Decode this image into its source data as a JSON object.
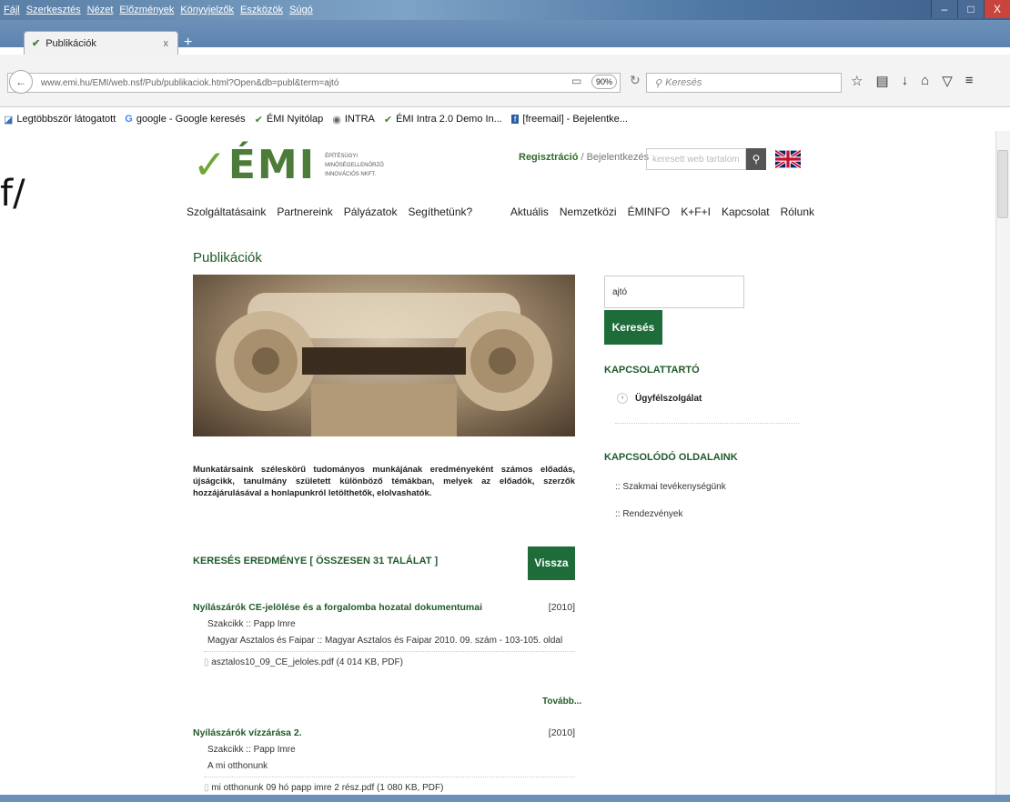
{
  "menu": [
    "Fájl",
    "Szerkesztés",
    "Nézet",
    "Előzmények",
    "Könyvjelzők",
    "Eszközök",
    "Súgó"
  ],
  "tab": {
    "title": "Publikációk",
    "close": "x",
    "new": "+"
  },
  "window_controls": [
    "–",
    "□",
    "X"
  ],
  "urlbar": {
    "url": "www.emi.hu/EMI/web.nsf/Pub/publikaciok.html?Open&db=publ&term=ajtó",
    "zoom": "90%",
    "search_placeholder": "Keresés"
  },
  "bookmarks": [
    "Legtöbbször látogatott",
    "google - Google keresés",
    "ÉMI Nyitólap",
    "INTRA",
    "ÉMI Intra 2.0 Demo In...",
    "[freemail] - Bejelentke..."
  ],
  "left_fragment": "f/",
  "logo": {
    "mark": "ÉMI",
    "text": [
      "ÉPÍTÉSÜGYI",
      "MINŐSÉGELLENŐRZŐ",
      "INNOVÁCIÓS NKFT."
    ]
  },
  "header": {
    "register": "Regisztráció",
    "slash": " / ",
    "login": "Bejelentkezés",
    "search_placeholder": "keresett web tartalom"
  },
  "nav": {
    "left": [
      "Szolgáltatásaink",
      "Partnereink",
      "Pályázatok",
      "Segíthetünk?"
    ],
    "right": [
      "Aktuális",
      "Nemzetközi",
      "ÉMINFO",
      "K+F+I",
      "Kapcsolat",
      "Rólunk"
    ]
  },
  "page_title": "Publikációk",
  "intro": "Munkatársaink széleskörű tudományos munkájának eredményeként számos előadás, újságcikk, tanulmány született különböző témákban, melyek az előadók, szerzők hozzájárulásával a honlapunkról letölthetők, elolvashatók.",
  "results": {
    "header": "KERESÉS EREDMÉNYE [ ÖSSZESEN 31 TALÁLAT ]",
    "back_label": "Vissza",
    "items": [
      {
        "title": "Nyílászárók CE-jelölése és a forgalomba hozatal dokumentumai",
        "year": "[2010]",
        "author": "Szakcikk :: Papp Imre",
        "source": "Magyar Asztalos és Faipar :: Magyar Asztalos és Faipar 2010. 09. szám - 103-105. oldal",
        "file": "asztalos10_09_CE_jeloles.pdf (4 014 KB, PDF)",
        "more": "Tovább..."
      },
      {
        "title": "Nyílászárók vízzárása 2.",
        "year": "[2010]",
        "author": "Szakcikk :: Papp Imre",
        "source": "A mi otthonunk",
        "file": "mi otthonunk 09 hó  papp imre 2  rész.pdf (1 080 KB, PDF)"
      }
    ]
  },
  "sidebar": {
    "search_value": "ajtó",
    "search_button": "Keresés",
    "contact_heading": "KAPCSOLATTARTÓ",
    "contact_item": "Ügyfélszolgálat",
    "related_heading": "KAPCSOLÓDÓ OLDALAINK",
    "related_links": [
      ":: Szakmai tevékenységünk",
      ":: Rendezvények"
    ]
  }
}
